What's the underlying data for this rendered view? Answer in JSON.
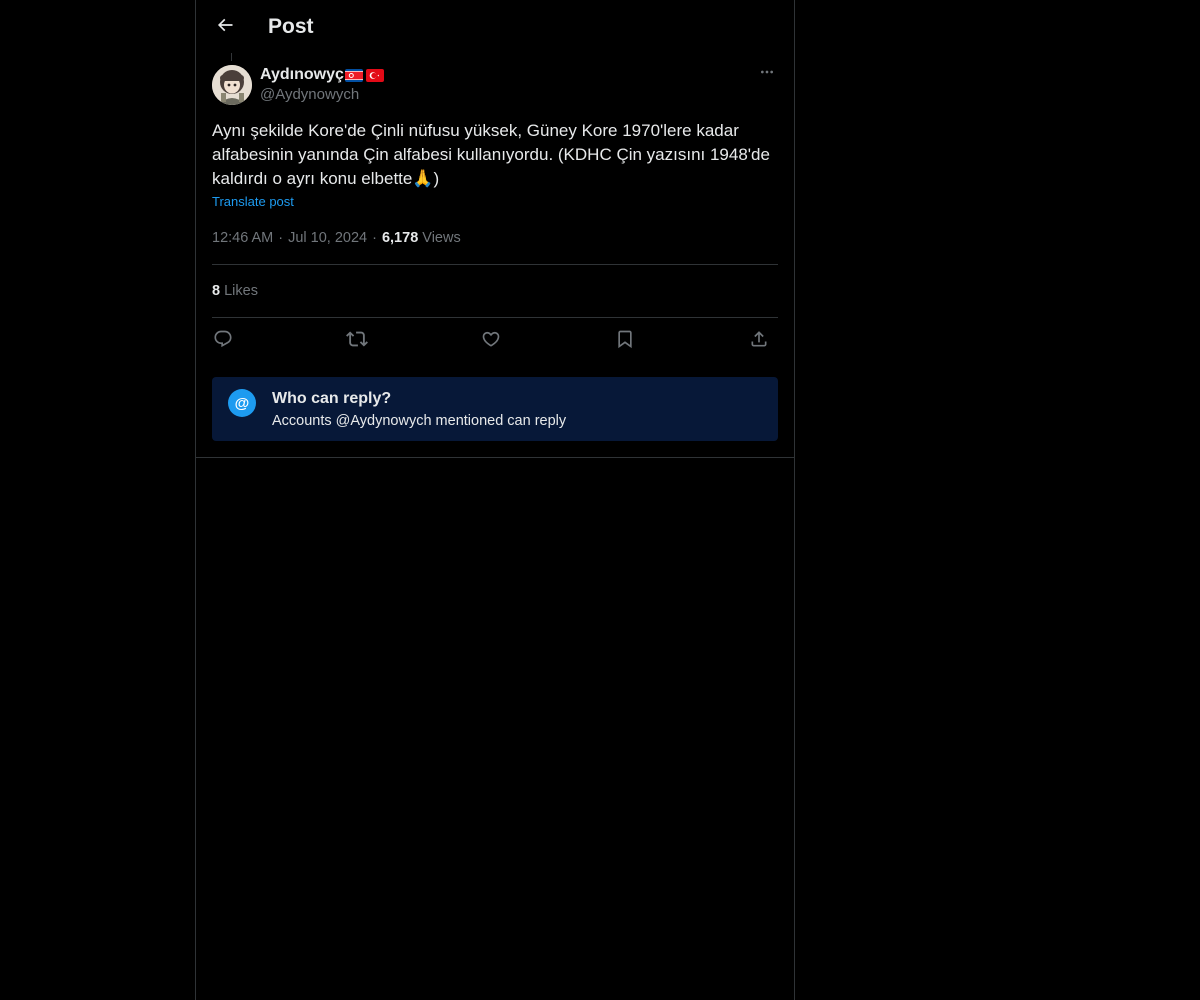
{
  "header": {
    "title": "Post",
    "back_icon": "arrow-left-icon"
  },
  "post": {
    "display_name": "Aydınowyç",
    "flags": [
      "north-korea-flag-icon",
      "turkey-flag-icon"
    ],
    "handle": "@Aydynowych",
    "text": "Aynı şekilde Kore'de Çinli nüfusu yüksek, Güney Kore 1970'lere kadar alfabesinin yanında Çin alfabesi kullanıyordu. (KDHC Çin yazısını 1948'de kaldırdı o ayrı konu elbette🙏)",
    "translate_label": "Translate post",
    "time": "12:46 AM",
    "date": "Jul 10, 2024",
    "views_count": "6,178",
    "views_label": "Views",
    "likes_count": "8",
    "likes_label": "Likes"
  },
  "actions": [
    "reply-icon",
    "repost-icon",
    "like-icon",
    "bookmark-icon",
    "share-icon"
  ],
  "reply_restriction": {
    "title": "Who can reply?",
    "description": "Accounts @Aydynowych mentioned can reply",
    "icon_text": "@"
  },
  "colors": {
    "background": "#000000",
    "text": "#e7e9ea",
    "secondary_text": "#71767b",
    "accent": "#1d9bf0",
    "reply_box_bg": "#071838",
    "border": "#2f3336"
  }
}
